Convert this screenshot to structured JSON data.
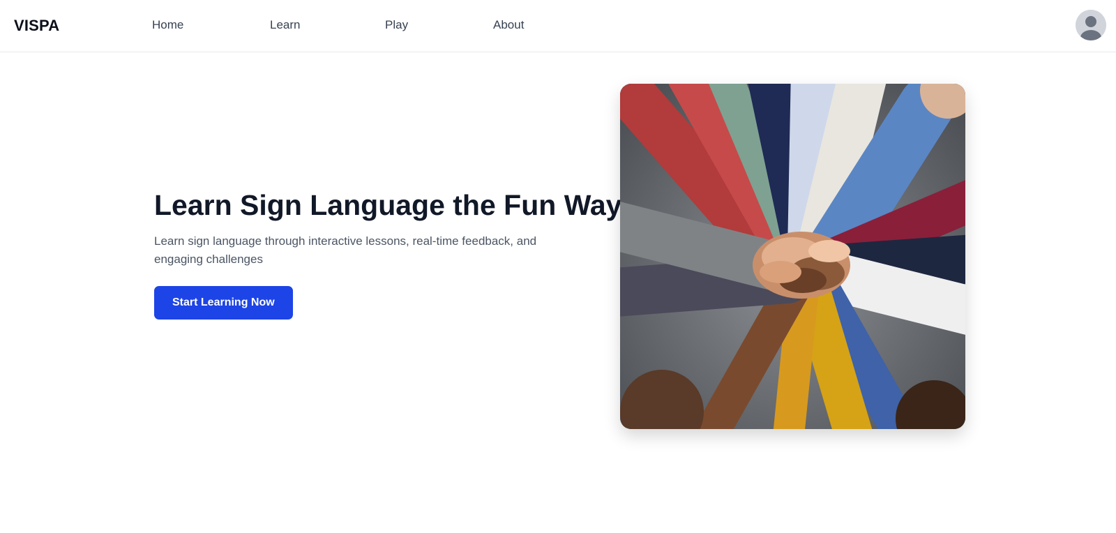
{
  "header": {
    "brand": "VISPA",
    "nav": [
      {
        "label": "Home"
      },
      {
        "label": "Learn"
      },
      {
        "label": "Play"
      },
      {
        "label": "About"
      }
    ],
    "avatar_icon": "user-avatar-icon"
  },
  "hero": {
    "title": "Learn Sign Language the Fun Way",
    "subtitle": "Learn sign language through interactive lessons, real-time feedback, and engaging challenges",
    "cta_label": "Start Learning Now",
    "image_subject": "hands-stacked-photo"
  },
  "colors": {
    "accent": "#1d44e6",
    "title": "#111827",
    "body_text": "#4b5563",
    "nav_text": "#374151"
  }
}
